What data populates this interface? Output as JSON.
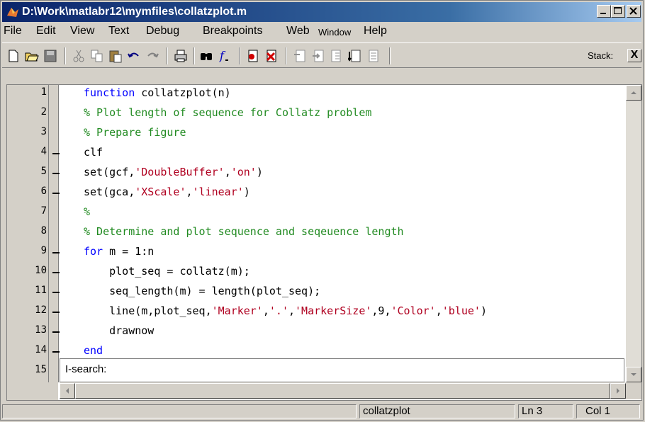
{
  "window": {
    "title": "D:\\Work\\matlabr12\\mymfiles\\collatzplot.m",
    "minimize_label": "_",
    "maximize_label": "□",
    "close_label": "×"
  },
  "menu": {
    "file": "File",
    "edit": "Edit",
    "view": "View",
    "text": "Text",
    "debug": "Debug",
    "breakpoints": "Breakpoints",
    "web": "Web",
    "window": "Window",
    "help": "Help"
  },
  "toolbar": {
    "stack_label": "Stack:",
    "stack_close": "X",
    "icons": [
      "new-file-icon",
      "open-folder-icon",
      "save-icon",
      "cut-icon",
      "copy-icon",
      "paste-icon",
      "undo-icon",
      "redo-icon",
      "print-icon",
      "find-icon",
      "function-icon",
      "set-breakpoint-icon",
      "clear-breakpoints-icon",
      "step-icon",
      "step-in-icon",
      "step-out-icon",
      "continue-icon",
      "exit-debug-icon"
    ]
  },
  "editor": {
    "line_numbers": [
      "1",
      "2",
      "3",
      "4",
      "5",
      "6",
      "7",
      "8",
      "9",
      "10",
      "11",
      "12",
      "13",
      "14",
      "15"
    ],
    "breakpoint_dash_lines": [
      4,
      5,
      6,
      9,
      10,
      11,
      12,
      13,
      14
    ],
    "lines": [
      [
        {
          "t": "function",
          "c": "kw"
        },
        {
          "t": " collatzplot(n)",
          "c": ""
        }
      ],
      [
        {
          "t": "% Plot length of sequence for Collatz problem",
          "c": "cm"
        }
      ],
      [
        {
          "t": "% Prepare figure",
          "c": "cm"
        }
      ],
      [
        {
          "t": "clf",
          "c": ""
        }
      ],
      [
        {
          "t": "set(gcf,",
          "c": ""
        },
        {
          "t": "'DoubleBuffer'",
          "c": "st"
        },
        {
          "t": ",",
          "c": ""
        },
        {
          "t": "'on'",
          "c": "st"
        },
        {
          "t": ")",
          "c": ""
        }
      ],
      [
        {
          "t": "set(gca,",
          "c": ""
        },
        {
          "t": "'XScale'",
          "c": "st"
        },
        {
          "t": ",",
          "c": ""
        },
        {
          "t": "'linear'",
          "c": "st"
        },
        {
          "t": ")",
          "c": ""
        }
      ],
      [
        {
          "t": "%",
          "c": "cm"
        }
      ],
      [
        {
          "t": "% Determine and plot sequence and seqeuence length",
          "c": "cm"
        }
      ],
      [
        {
          "t": "for",
          "c": "kw"
        },
        {
          "t": " m = 1:n",
          "c": ""
        }
      ],
      [
        {
          "t": "    plot_seq = collatz(m);",
          "c": ""
        }
      ],
      [
        {
          "t": "    seq_length(m) = length(plot_seq);",
          "c": ""
        }
      ],
      [
        {
          "t": "    line(m,plot_seq,",
          "c": ""
        },
        {
          "t": "'Marker'",
          "c": "st"
        },
        {
          "t": ",",
          "c": ""
        },
        {
          "t": "'.'",
          "c": "st"
        },
        {
          "t": ",",
          "c": ""
        },
        {
          "t": "'MarkerSize'",
          "c": "st"
        },
        {
          "t": ",9,",
          "c": ""
        },
        {
          "t": "'Color'",
          "c": "st"
        },
        {
          "t": ",",
          "c": ""
        },
        {
          "t": "'blue'",
          "c": "st"
        },
        {
          "t": ")",
          "c": ""
        }
      ],
      [
        {
          "t": "    drawnow",
          "c": ""
        }
      ],
      [
        {
          "t": "end",
          "c": "kw"
        }
      ]
    ],
    "isearch_label": "I-search:",
    "colors": {
      "keyword": "#0000ff",
      "comment": "#228b22",
      "string": "#b00020"
    }
  },
  "status": {
    "function_name": "collatzplot",
    "line": "Ln 3",
    "col": "Col 1"
  }
}
